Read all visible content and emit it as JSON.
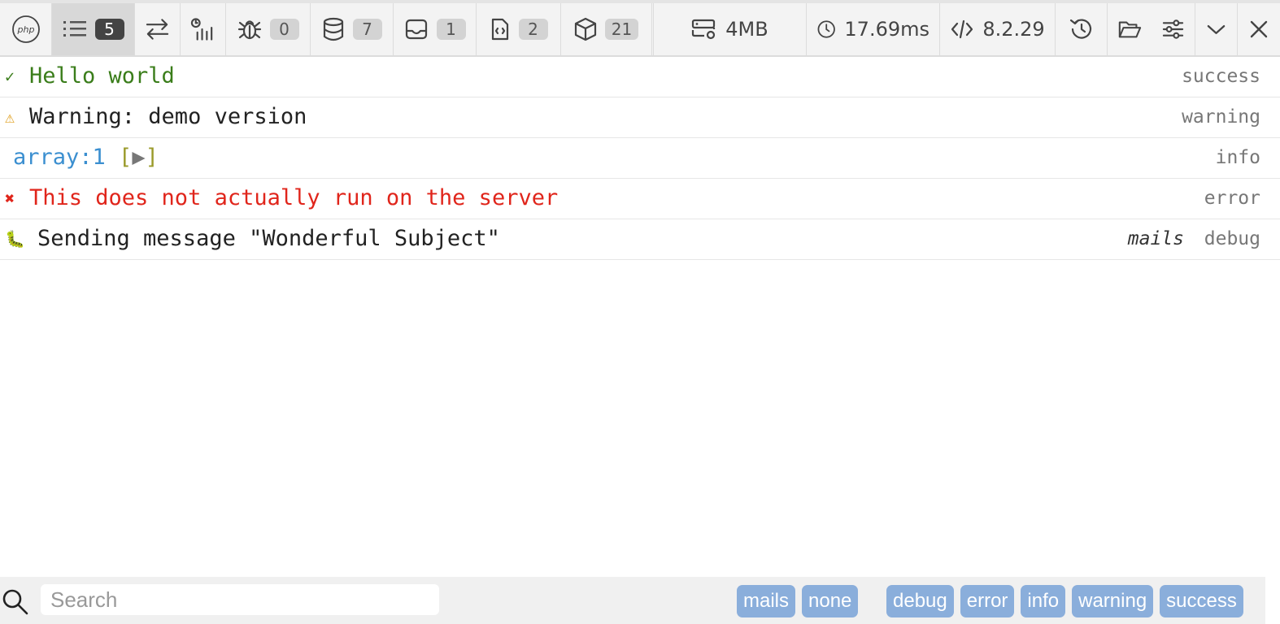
{
  "toolbar": {
    "logs_count": "5",
    "exceptions_count": "0",
    "queries_count": "7",
    "mails_count": "1",
    "views_count": "2",
    "models_count": "21",
    "memory": "4MB",
    "duration": "17.69ms",
    "php_version": "8.2.29"
  },
  "messages": [
    {
      "glyph": "✓",
      "text": "Hello world",
      "channel": "",
      "level": "success"
    },
    {
      "glyph": "⚠",
      "text": "Warning: demo version",
      "channel": "",
      "level": "warning"
    },
    {
      "glyph": "",
      "text_prefix": "array:1 ",
      "bracket_open": "[",
      "triangle": "▶",
      "bracket_close": "]",
      "channel": "",
      "level": "info"
    },
    {
      "glyph": "✖",
      "text": "This does not actually run on the server",
      "channel": "",
      "level": "error"
    },
    {
      "glyph": "🐛",
      "text": "Sending message \"Wonderful Subject\"",
      "channel": "mails",
      "level": "debug"
    }
  ],
  "footer": {
    "search_placeholder": "Search",
    "channel_filters": [
      "mails",
      "none"
    ],
    "level_filters": [
      "debug",
      "error",
      "info",
      "warning",
      "success"
    ]
  },
  "colors": {
    "success": "#3a7d1a",
    "warning": "#e0a020",
    "error": "#e0251b",
    "info": "#3b8fd0",
    "filter_bg": "#8aaedb"
  }
}
